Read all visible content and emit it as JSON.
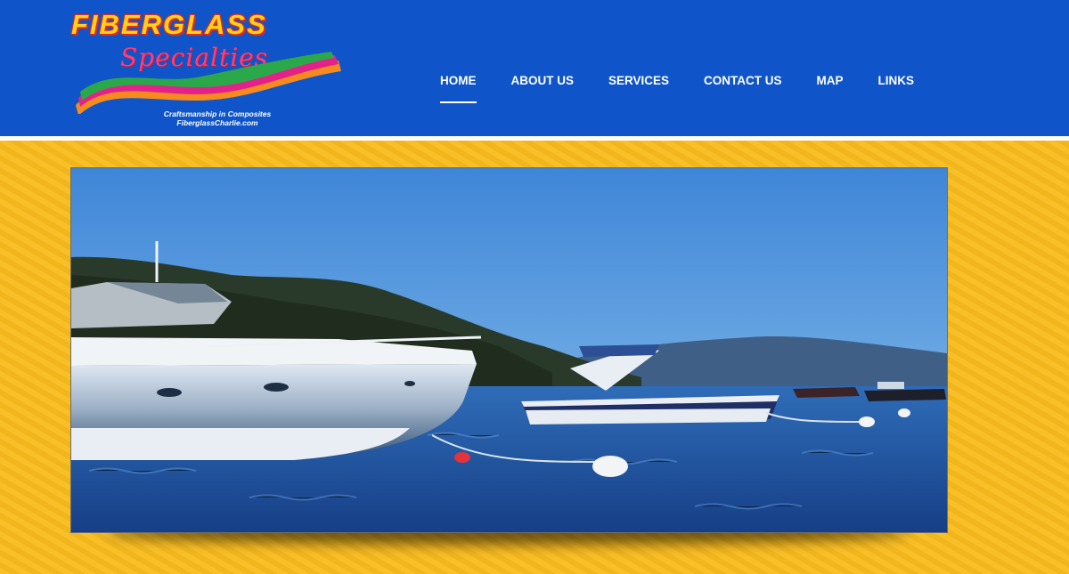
{
  "logo": {
    "name": "FIBERGLASS",
    "script": "Specialties",
    "tagline": "Craftsmanship in Composites",
    "website": "FiberglassCharlie.com"
  },
  "nav": {
    "items": [
      {
        "label": "HOME",
        "active": true
      },
      {
        "label": "ABOUT US",
        "active": false
      },
      {
        "label": "SERVICES",
        "active": false
      },
      {
        "label": "CONTACT US",
        "active": false
      },
      {
        "label": "MAP",
        "active": false
      },
      {
        "label": "LINKS",
        "active": false
      }
    ]
  },
  "hero": {
    "image": "boats-on-lake-photo"
  },
  "colors": {
    "header_bg": "#0f55c9",
    "page_bg": "#f9bc1d",
    "nav_text": "#ffffff"
  }
}
